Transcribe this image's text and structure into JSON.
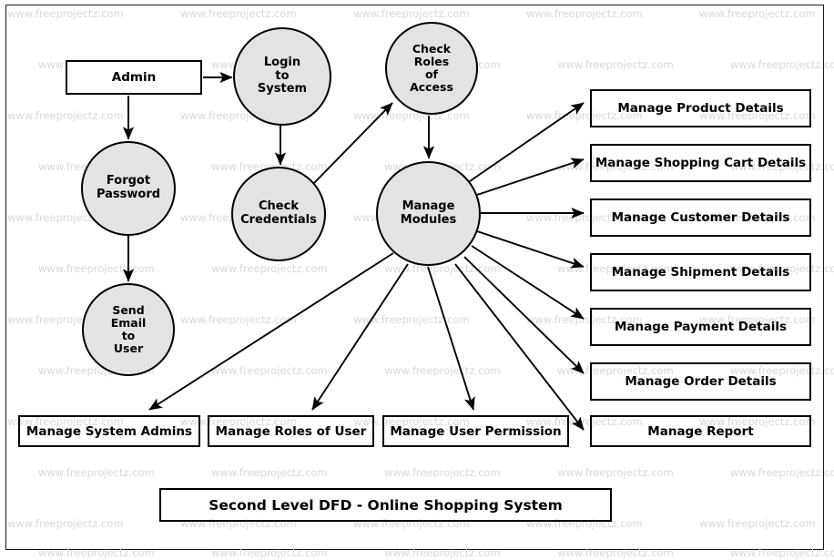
{
  "diagram": {
    "title": "Second Level DFD - Online Shopping System",
    "watermark_text": "www.freeprojectz.com",
    "colors": {
      "process_fill": "#e3e3e3",
      "stroke": "#000000",
      "watermark": "#d8d8d8",
      "background": "#ffffff"
    }
  },
  "entities": [
    {
      "id": "admin",
      "label": "Admin"
    }
  ],
  "processes": [
    {
      "id": "login_to_system",
      "label": "Login\nto\nSystem",
      "lines": [
        "Login",
        "to",
        "System"
      ]
    },
    {
      "id": "check_roles",
      "label": "Check\nRoles\nof\nAccess",
      "lines": [
        "Check",
        "Roles",
        "of",
        "Access"
      ]
    },
    {
      "id": "forgot_password",
      "label": "Forgot\nPassword",
      "lines": [
        "Forgot",
        "Password"
      ]
    },
    {
      "id": "check_credentials",
      "label": "Check\nCredentials",
      "lines": [
        "Check",
        "Credentials"
      ]
    },
    {
      "id": "manage_modules",
      "label": "Manage\nModules",
      "lines": [
        "Manage",
        "Modules"
      ]
    },
    {
      "id": "send_email_to_user",
      "label": "Send\nEmail\nto\nUser",
      "lines": [
        "Send",
        "Email",
        "to",
        "User"
      ]
    }
  ],
  "data_stores_right": [
    {
      "id": "manage_product_details",
      "label": "Manage Product Details"
    },
    {
      "id": "manage_shopping_cart_details",
      "label": "Manage Shopping Cart Details"
    },
    {
      "id": "manage_customer_details",
      "label": "Manage Customer Details"
    },
    {
      "id": "manage_shipment_details",
      "label": "Manage Shipment Details"
    },
    {
      "id": "manage_payment_details",
      "label": "Manage Payment Details"
    },
    {
      "id": "manage_order_details",
      "label": "Manage Order Details"
    },
    {
      "id": "manage_report",
      "label": "Manage Report"
    }
  ],
  "data_stores_bottom": [
    {
      "id": "manage_system_admins",
      "label": "Manage System Admins"
    },
    {
      "id": "manage_roles_of_user",
      "label": "Manage Roles of User"
    },
    {
      "id": "manage_user_permission",
      "label": "Manage User Permission"
    }
  ],
  "flows": [
    {
      "from": "admin",
      "to": "login_to_system"
    },
    {
      "from": "admin",
      "to": "forgot_password"
    },
    {
      "from": "forgot_password",
      "to": "send_email_to_user"
    },
    {
      "from": "login_to_system",
      "to": "check_credentials"
    },
    {
      "from": "check_credentials",
      "to": "check_roles"
    },
    {
      "from": "check_roles",
      "to": "manage_modules"
    },
    {
      "from": "manage_modules",
      "to": "manage_product_details"
    },
    {
      "from": "manage_modules",
      "to": "manage_shopping_cart_details"
    },
    {
      "from": "manage_modules",
      "to": "manage_customer_details"
    },
    {
      "from": "manage_modules",
      "to": "manage_shipment_details"
    },
    {
      "from": "manage_modules",
      "to": "manage_payment_details"
    },
    {
      "from": "manage_modules",
      "to": "manage_order_details"
    },
    {
      "from": "manage_modules",
      "to": "manage_report"
    },
    {
      "from": "manage_modules",
      "to": "manage_system_admins"
    },
    {
      "from": "manage_modules",
      "to": "manage_roles_of_user"
    },
    {
      "from": "manage_modules",
      "to": "manage_user_permission"
    }
  ]
}
